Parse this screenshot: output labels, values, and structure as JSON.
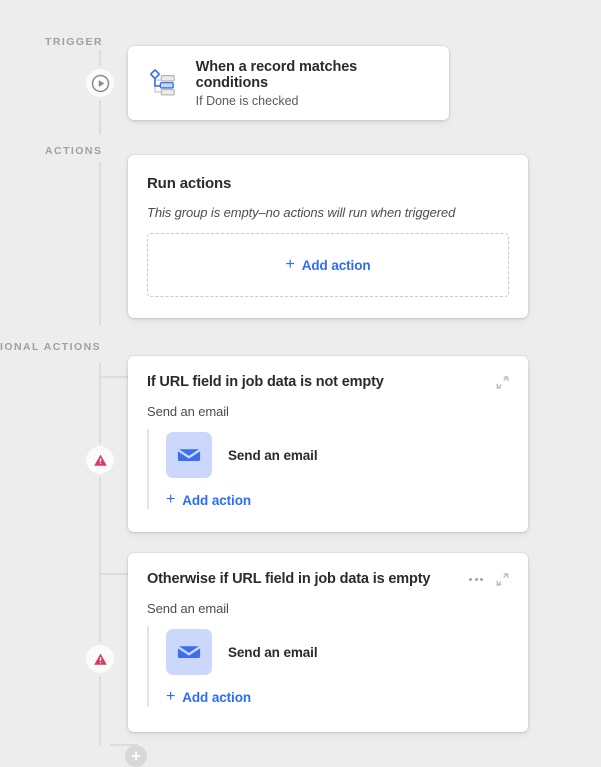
{
  "colors": {
    "background": "#ededed",
    "card": "#ffffff",
    "accent_blue": "#2d6cf6",
    "mail_tile": "#ccd8fb",
    "rail": "#dcdcdc",
    "warning_red": "#d93a5e",
    "label_gray": "#a0a0a0"
  },
  "rail": {
    "labels": [
      {
        "text": "TRIGGER"
      },
      {
        "text": "ACTIONS"
      },
      {
        "text": "IONAL ACTIONS"
      }
    ],
    "nodes": [
      {
        "name": "trigger-play-node",
        "icon": "play-circle-icon"
      },
      {
        "name": "warning-node-1",
        "icon": "warning-triangle-icon"
      },
      {
        "name": "warning-node-2",
        "icon": "warning-triangle-icon"
      },
      {
        "name": "add-step-node",
        "icon": "plus-icon"
      }
    ]
  },
  "trigger": {
    "icon": "record-conditions-icon",
    "title": "When a record matches conditions",
    "subtitle": "If Done is checked"
  },
  "run_actions": {
    "title": "Run actions",
    "empty_message": "This group is empty–no actions will run when triggered",
    "add_action_label": "Add action",
    "add_plus": "+"
  },
  "conditions": [
    {
      "title": "If URL field in job data is not empty",
      "subtitle": "Send an email",
      "has_overflow_menu": false,
      "collapse_icon": "collapse-diagonal-icon",
      "actions": [
        {
          "icon": "envelope-icon",
          "label": "Send an email"
        }
      ],
      "add_action_label": "Add action",
      "add_plus": "+"
    },
    {
      "title": "Otherwise if URL field in job data is empty",
      "subtitle": "Send an email",
      "has_overflow_menu": true,
      "overflow_icon": "more-horizontal-icon",
      "collapse_icon": "collapse-diagonal-icon",
      "actions": [
        {
          "icon": "envelope-icon",
          "label": "Send an email"
        }
      ],
      "add_action_label": "Add action",
      "add_plus": "+"
    }
  ]
}
